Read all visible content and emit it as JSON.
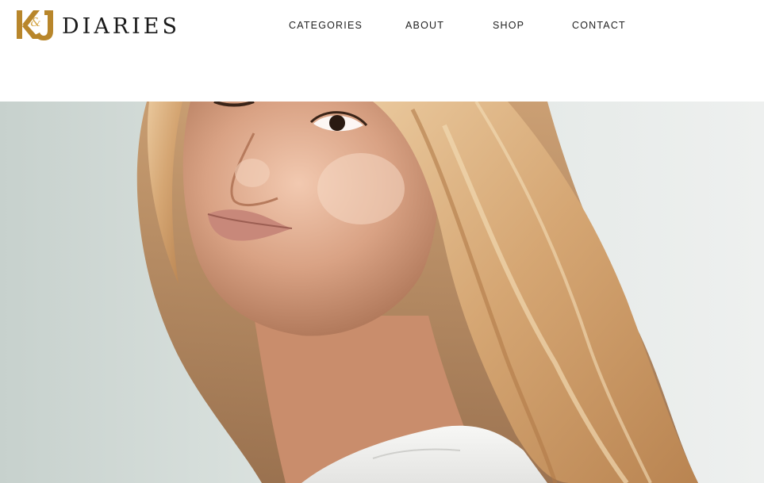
{
  "brand": {
    "monogram": "K&J",
    "wordmark": "DIARIES",
    "gold_color": "#b8862b"
  },
  "nav": {
    "items": [
      {
        "label": "CATEGORIES"
      },
      {
        "label": "ABOUT"
      },
      {
        "label": "SHOP"
      },
      {
        "label": "CONTACT"
      }
    ]
  },
  "hero": {
    "image": "portrait-photo",
    "subject": "woman with long blonde wavy hair looking over shoulder, white top, light grey background"
  }
}
